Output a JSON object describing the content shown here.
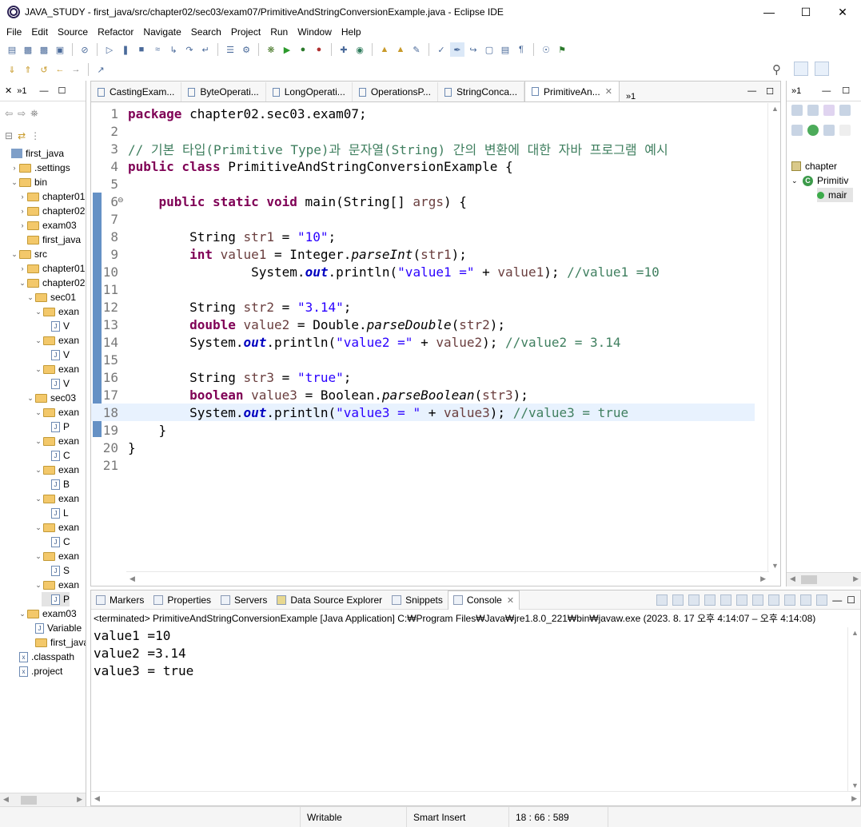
{
  "window": {
    "title": "JAVA_STUDY - first_java/src/chapter02/sec03/exam07/PrimitiveAndStringConversionExample.java - Eclipse IDE"
  },
  "menu": [
    "File",
    "Edit",
    "Source",
    "Refactor",
    "Navigate",
    "Search",
    "Project",
    "Run",
    "Window",
    "Help"
  ],
  "package_explorer": {
    "items": [
      {
        "label": "first_java",
        "type": "project"
      },
      {
        "label": ".settings",
        "type": "folder"
      },
      {
        "label": "bin",
        "type": "folder"
      },
      {
        "label": "chapter01",
        "type": "folder"
      },
      {
        "label": "chapter02",
        "type": "folder"
      },
      {
        "label": "exam03",
        "type": "folder"
      },
      {
        "label": "first_java",
        "type": "folder"
      },
      {
        "label": "src",
        "type": "folder"
      },
      {
        "label": "chapter01",
        "type": "folder"
      },
      {
        "label": "chapter02",
        "type": "folder"
      },
      {
        "label": "sec01",
        "type": "folder"
      },
      {
        "label": "exan",
        "type": "folder"
      },
      {
        "label": "V",
        "type": "java"
      },
      {
        "label": "exan",
        "type": "folder"
      },
      {
        "label": "V",
        "type": "java"
      },
      {
        "label": "exan",
        "type": "folder"
      },
      {
        "label": "V",
        "type": "java"
      },
      {
        "label": "sec03",
        "type": "folder"
      },
      {
        "label": "exan",
        "type": "folder"
      },
      {
        "label": "P",
        "type": "java"
      },
      {
        "label": "exan",
        "type": "folder"
      },
      {
        "label": "C",
        "type": "java"
      },
      {
        "label": "exan",
        "type": "folder"
      },
      {
        "label": "B",
        "type": "java"
      },
      {
        "label": "exan",
        "type": "folder"
      },
      {
        "label": "L",
        "type": "java"
      },
      {
        "label": "exan",
        "type": "folder"
      },
      {
        "label": "C",
        "type": "java"
      },
      {
        "label": "exan",
        "type": "folder"
      },
      {
        "label": "S",
        "type": "java"
      },
      {
        "label": "exan",
        "type": "folder"
      },
      {
        "label": "P",
        "type": "java"
      },
      {
        "label": "exam03",
        "type": "folder"
      },
      {
        "label": "Variable",
        "type": "java"
      },
      {
        "label": "first_java",
        "type": "folder"
      },
      {
        "label": ".classpath",
        "type": "xml"
      },
      {
        "label": ".project",
        "type": "xml"
      }
    ]
  },
  "editor": {
    "tabs": [
      {
        "label": "CastingExam..."
      },
      {
        "label": "ByteOperati..."
      },
      {
        "label": "LongOperati..."
      },
      {
        "label": "OperationsP..."
      },
      {
        "label": "StringConca..."
      },
      {
        "label": "PrimitiveAn...",
        "active": true
      }
    ],
    "overflow": "»1",
    "lines": [
      {
        "n": "1"
      },
      {
        "n": "2"
      },
      {
        "n": "3"
      },
      {
        "n": "4"
      },
      {
        "n": "5"
      },
      {
        "n": "6"
      },
      {
        "n": "7"
      },
      {
        "n": "8"
      },
      {
        "n": "9"
      },
      {
        "n": "10"
      },
      {
        "n": "11"
      },
      {
        "n": "12"
      },
      {
        "n": "13"
      },
      {
        "n": "14"
      },
      {
        "n": "15"
      },
      {
        "n": "16"
      },
      {
        "n": "17"
      },
      {
        "n": "18"
      },
      {
        "n": "19"
      },
      {
        "n": "20"
      },
      {
        "n": "21"
      }
    ],
    "code": {
      "l1_kw": "package",
      "l1_rest": " chapter02.sec03.exam07;",
      "l3_comment": "// 기본 타입(Primitive Type)과 문자열(String) 간의 변환에 대한 자바 프로그램 예시",
      "l4_kw": "public class",
      "l4_rest": " PrimitiveAndStringConversionExample {",
      "l6_kw": "public static void",
      "l6_rest1": " main(String[] ",
      "l6_var": "args",
      "l6_rest2": ") {",
      "l8_a": "String ",
      "l8_var": "str1",
      "l8_b": " = ",
      "l8_str": "\"10\"",
      "l8_c": ";",
      "l9_kw": "int",
      "l9_var": " value1",
      "l9_a": " = Integer.",
      "l9_it": "parseInt",
      "l9_b": "(",
      "l9_var2": "str1",
      "l9_c": ");",
      "l10_a": "System.",
      "l10_fld": "out",
      "l10_b": ".println(",
      "l10_str": "\"value1 =\"",
      "l10_c": " + ",
      "l10_var": "value1",
      "l10_d": "); ",
      "l10_cm": "//value1 =10",
      "l12_a": "String ",
      "l12_var": "str2",
      "l12_b": " = ",
      "l12_str": "\"3.14\"",
      "l12_c": ";",
      "l13_kw": "double",
      "l13_var": " value2",
      "l13_a": " = Double.",
      "l13_it": "parseDouble",
      "l13_b": "(",
      "l13_var2": "str2",
      "l13_c": ");",
      "l14_a": "System.",
      "l14_fld": "out",
      "l14_b": ".println(",
      "l14_str": "\"value2 =\"",
      "l14_c": " + ",
      "l14_var": "value2",
      "l14_d": "); ",
      "l14_cm": "//value2 = 3.14",
      "l16_a": "String ",
      "l16_var": "str3",
      "l16_b": " = ",
      "l16_str": "\"true\"",
      "l16_c": ";",
      "l17_kw": "boolean",
      "l17_var": " value3",
      "l17_a": " = Boolean.",
      "l17_it": "parseBoolean",
      "l17_b": "(",
      "l17_var2": "str3",
      "l17_c": ");",
      "l18_a": "System.",
      "l18_fld": "out",
      "l18_b": ".println(",
      "l18_str": "\"value3 = \"",
      "l18_c": " + ",
      "l18_var": "value3",
      "l18_d": "); ",
      "l18_cm": "//value3 = true",
      "l19": "}",
      "l20": "}"
    }
  },
  "outline": {
    "overflow": "»1",
    "items": [
      {
        "label": "chapter",
        "type": "package"
      },
      {
        "label": "Primitiv",
        "type": "class"
      },
      {
        "label": "mair",
        "type": "method"
      }
    ]
  },
  "console": {
    "tabs": [
      {
        "label": "Markers"
      },
      {
        "label": "Properties"
      },
      {
        "label": "Servers"
      },
      {
        "label": "Data Source Explorer"
      },
      {
        "label": "Snippets"
      },
      {
        "label": "Console",
        "active": true
      }
    ],
    "status": "<terminated> PrimitiveAndStringConversionExample [Java Application] C:₩Program Files₩Java₩jre1.8.0_221₩bin₩javaw.exe  (2023. 8. 17 오후 4:14:07 – 오후 4:14:08)",
    "output": [
      "value1 =10",
      "value2 =3.14",
      "value3 = true"
    ]
  },
  "statusbar": {
    "mode": "Writable",
    "insert": "Smart Insert",
    "position": "18 : 66 : 589"
  }
}
